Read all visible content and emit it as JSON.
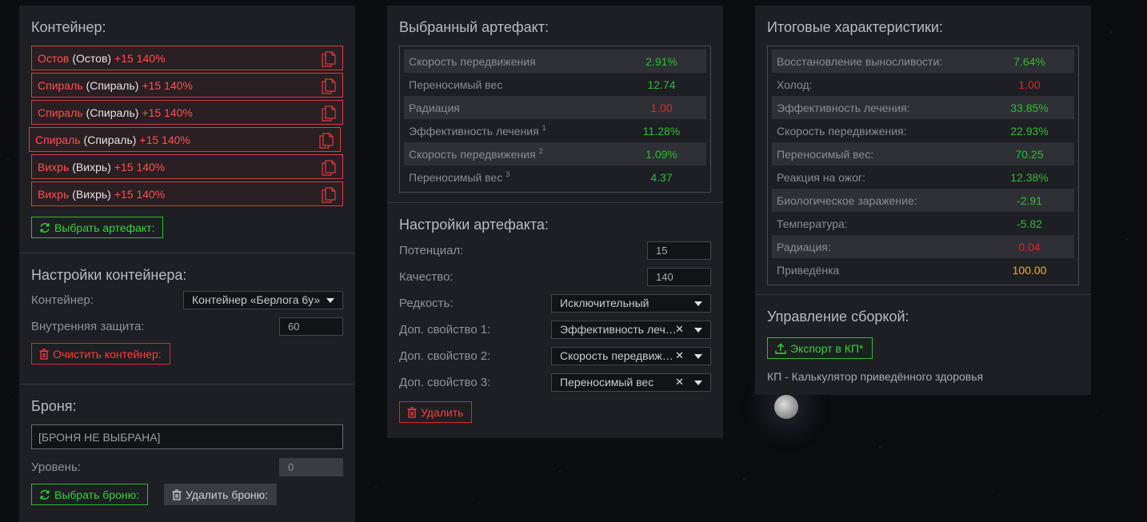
{
  "container_panel": {
    "title": "Контейнер:",
    "items": [
      {
        "name": "Остов",
        "type": "(Остов)",
        "level": "+15 140%"
      },
      {
        "name": "Спираль",
        "type": "(Спираль)",
        "level": "+15 140%"
      },
      {
        "name": "Спираль",
        "type": "(Спираль)",
        "level": "+15 140%"
      },
      {
        "name": "Спираль",
        "type": "(Спираль)",
        "level": "+15 140%"
      },
      {
        "name": "Вихрь",
        "type": "(Вихрь)",
        "level": "+15 140%"
      },
      {
        "name": "Вихрь",
        "type": "(Вихрь)",
        "level": "+15 140%"
      }
    ],
    "select_artifact_label": "Выбрать артефакт:"
  },
  "container_settings": {
    "title": "Настройки контейнера:",
    "container_label": "Контейнер:",
    "container_value": "Контейнер «Берлога 6у»",
    "protection_label": "Внутренняя защита:",
    "protection_value": "60",
    "clear_label": "Очистить контейнер:"
  },
  "armor": {
    "title": "Броня:",
    "value": "[БРОНЯ НЕ ВЫБРАНА]",
    "level_label": "Уровень:",
    "level_value": "0",
    "select_label": "Выбрать броню:",
    "delete_label": "Удалить броню:"
  },
  "selected_artifact": {
    "title": "Выбранный артефакт:",
    "stats": [
      {
        "label": "Скорость передвижения",
        "sup": "",
        "value": "2.91%",
        "color": "g"
      },
      {
        "label": "Переносимый вес",
        "sup": "",
        "value": "12.74",
        "color": "g"
      },
      {
        "label": "Радиация",
        "sup": "",
        "value": "1.00",
        "color": "r"
      },
      {
        "label": "Эффективность лечения",
        "sup": "1",
        "value": "11.28%",
        "color": "g"
      },
      {
        "label": "Скорость передвижения",
        "sup": "2",
        "value": "1.09%",
        "color": "g"
      },
      {
        "label": "Переносимый вес",
        "sup": "3",
        "value": "4.37",
        "color": "g"
      }
    ]
  },
  "artifact_settings": {
    "title": "Настройки артефакта:",
    "potential_label": "Потенциал:",
    "potential_value": "15",
    "quality_label": "Качество:",
    "quality_value": "140",
    "rarity_label": "Редкость:",
    "rarity_value": "Исключительный",
    "prop1_label": "Доп. свойство 1:",
    "prop1_value": "Эффективность лечения",
    "prop2_label": "Доп. свойство 2:",
    "prop2_value": "Скорость передвижения",
    "prop3_label": "Доп. свойство 3:",
    "prop3_value": "Переносимый вес",
    "delete_label": "Удалить"
  },
  "totals": {
    "title": "Итоговые характеристики:",
    "stats": [
      {
        "label": "Восстановление выносливости:",
        "value": "7.64%",
        "color": "g"
      },
      {
        "label": "Холод:",
        "value": "1.00",
        "color": "r"
      },
      {
        "label": "Эффективность лечения:",
        "value": "33.85%",
        "color": "g"
      },
      {
        "label": "Скорость передвижения:",
        "value": "22.93%",
        "color": "g"
      },
      {
        "label": "Переносимый вес:",
        "value": "70.25",
        "color": "g"
      },
      {
        "label": "Реакция на ожог:",
        "value": "12.38%",
        "color": "g"
      },
      {
        "label": "Биологическое заражение:",
        "value": "-2.91",
        "color": "g"
      },
      {
        "label": "Температура:",
        "value": "-5.82",
        "color": "g"
      },
      {
        "label": "Радиация:",
        "value": "0.04",
        "color": "r"
      },
      {
        "label": "Приведёнка",
        "value": "100.00",
        "color": "y"
      }
    ]
  },
  "build_management": {
    "title": "Управление сборкой:",
    "export_label": "Экспорт в КП*",
    "note": "КП - Калькулятор приведённого здоровья"
  },
  "colors": {
    "accent_green": "#2ebd2e",
    "accent_red": "#e02424",
    "accent_yellow": "#f2b01e",
    "panel_bg": "#1d1f24"
  }
}
